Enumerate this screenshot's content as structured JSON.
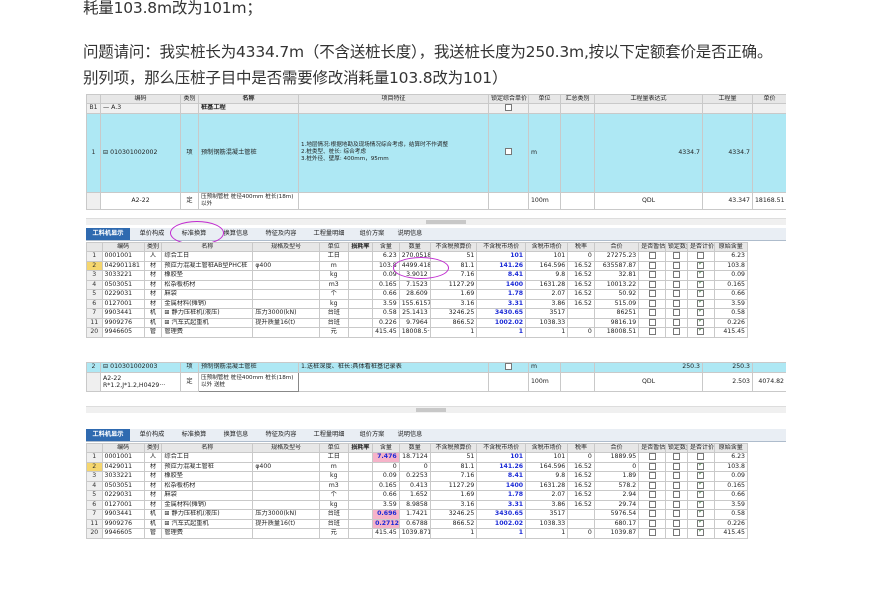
{
  "question": {
    "line0": "耗量103.8m改为101m；",
    "line1": "问题请问：我实桩长为4334.7m（不含送桩长度），我送桩长度为250.3m,按以下定额套价是否正确。",
    "line2": "别列项，那么压桩子目中是否需要修改消耗量103.8改为101）"
  },
  "top_grid": {
    "headers": [
      "编码",
      "类别",
      "名称",
      "项目特征",
      "锁定综合单价",
      "单位",
      "汇总类别",
      "工程量表达式",
      "工程量",
      "单价"
    ],
    "row_b1": {
      "num": "B1",
      "code": "— A.3",
      "name": "桩基工程"
    },
    "row_1": {
      "num": "1",
      "code": "010301002002",
      "type": "项",
      "name": "预制钢筋混凝土管桩",
      "feature": "1.地层情况:根据地勘及现场情况综合考虑，结算时不作调整\n2.桩类型、桩长: 综合考虑\n3.桩外径、壁厚: 400mm，95mm",
      "unit": "m",
      "expr": "4334.7",
      "qty": "4334.7"
    },
    "row_sub": {
      "code": "A2-22",
      "type": "定",
      "name": "压预制管桩 桩径400mm 桩长(18m)以外",
      "unit": "100m",
      "expr": "QDL",
      "qty": "43.347",
      "price": "18168.51"
    }
  },
  "tabs": [
    "工料机显示",
    "单价构成",
    "标准换算",
    "换算信息",
    "特征及内容",
    "工程量明细",
    "组价方案",
    "说明信息"
  ],
  "mat_headers": [
    "编码",
    "类别",
    "名称",
    "规格及型号",
    "单位",
    "损耗率",
    "含量",
    "数量",
    "不含税预算价",
    "不含税市场价",
    "含税市场价",
    "税率",
    "合价",
    "是否暂估",
    "锁定数量",
    "是否计价",
    "原始含量"
  ],
  "mat1_rows": [
    {
      "n": "1",
      "code": "0001001",
      "t": "人",
      "name": "综合工日",
      "spec": "",
      "unit": "工日",
      "loss": "",
      "qty": "6.23",
      "amt": "270.0518",
      "bud": "51",
      "mkt": "101",
      "tax": "101",
      "rate": "0",
      "sum": "27275.23",
      "chk": false,
      "orig": "6.23"
    },
    {
      "n": "2",
      "code": "042901181",
      "t": "材",
      "name": "预应力混凝土管桩AB型PHC桩",
      "spec": "φ400",
      "unit": "m",
      "loss": "",
      "qty": "103.8",
      "amt": "4499.4186",
      "bud": "81.1",
      "mkt": "141.26",
      "tax": "164.596",
      "rate": "16.52",
      "sum": "635587.87",
      "chk": true,
      "orig": "103.8"
    },
    {
      "n": "3",
      "code": "3033221",
      "t": "材",
      "name": "橡胶垫",
      "spec": "",
      "unit": "kg",
      "loss": "",
      "qty": "0.09",
      "amt": "3.9012",
      "bud": "7.16",
      "mkt": "8.41",
      "tax": "9.8",
      "rate": "16.52",
      "sum": "32.81",
      "chk": true,
      "orig": "0.09"
    },
    {
      "n": "4",
      "code": "0503051",
      "t": "材",
      "name": "松杂板枋材",
      "spec": "",
      "unit": "m3",
      "loss": "",
      "qty": "0.165",
      "amt": "7.1523",
      "bud": "1127.29",
      "mkt": "1400",
      "tax": "1631.28",
      "rate": "16.52",
      "sum": "10013.22",
      "chk": true,
      "orig": "0.165"
    },
    {
      "n": "5",
      "code": "0229031",
      "t": "材",
      "name": "麻袋",
      "spec": "",
      "unit": "个",
      "loss": "",
      "qty": "0.66",
      "amt": "28.609",
      "bud": "1.69",
      "mkt": "1.78",
      "tax": "2.07",
      "rate": "16.52",
      "sum": "50.92",
      "chk": true,
      "orig": "0.66"
    },
    {
      "n": "6",
      "code": "0127001",
      "t": "材",
      "name": "金属材料(摊销)",
      "spec": "",
      "unit": "kg",
      "loss": "",
      "qty": "3.59",
      "amt": "155.6157",
      "bud": "3.16",
      "mkt": "3.31",
      "tax": "3.86",
      "rate": "16.52",
      "sum": "515.09",
      "chk": true,
      "orig": "3.59"
    },
    {
      "n": "7",
      "code": "9903441",
      "t": "机",
      "name": "静力压桩机(液压)",
      "spec": "压力3000(kN)",
      "unit": "台班",
      "loss": "",
      "qty": "0.58",
      "amt": "25.1413",
      "bud": "3246.25",
      "mkt": "3430.65",
      "tax": "3517",
      "rate": "",
      "sum": "86251",
      "chk": true,
      "orig": "0.58"
    },
    {
      "n": "11",
      "code": "9909276",
      "t": "机",
      "name": "汽车式起重机",
      "spec": "提升质量16(t)",
      "unit": "台班",
      "loss": "",
      "qty": "0.226",
      "amt": "9.7964",
      "bud": "866.52",
      "mkt": "1002.02",
      "tax": "1038.33",
      "rate": "",
      "sum": "9816.19",
      "chk": true,
      "orig": "0.226"
    },
    {
      "n": "20",
      "code": "9946605",
      "t": "管",
      "name": "管理费",
      "spec": "",
      "unit": "元",
      "loss": "",
      "qty": "415.45",
      "amt": "18008.5···",
      "bud": "1",
      "mkt": "1",
      "tax": "1",
      "rate": "0",
      "sum": "18008.51",
      "chk": true,
      "orig": "415.45"
    }
  ],
  "mid_grid": {
    "row_2": {
      "num": "2",
      "code": "010301002003",
      "type": "项",
      "name": "预制钢筋混凝土管桩",
      "feature": "1.送桩深度、桩长:具体看桩基记录表",
      "unit": "m",
      "expr": "250.3",
      "qty": "250.3"
    },
    "row_sub": {
      "code": "A2-22",
      "code2": "R*1.2,J*1.2,H0429···",
      "type": "定",
      "name": "压预制管桩 桩径400mm 桩长(18m)以外 送桩",
      "unit": "100m",
      "expr": "QDL",
      "qty": "2.503",
      "price": "4074.82"
    }
  },
  "mat2_rows": [
    {
      "n": "1",
      "code": "0001001",
      "t": "人",
      "name": "综合工日",
      "spec": "",
      "unit": "工日",
      "loss": "",
      "qty": "7.476",
      "amt": "18.7124",
      "bud": "51",
      "mkt": "101",
      "tax": "101",
      "rate": "0",
      "sum": "1889.95",
      "chk": false,
      "orig": "6.23",
      "pinkqty": true
    },
    {
      "n": "2",
      "code": "0429011",
      "t": "材",
      "name": "预应力混凝土管桩",
      "spec": "φ400",
      "unit": "m",
      "loss": "",
      "qty": "0",
      "amt": "0",
      "bud": "81.1",
      "mkt": "141.26",
      "tax": "164.596",
      "rate": "16.52",
      "sum": "0",
      "chk": true,
      "orig": "103.8"
    },
    {
      "n": "3",
      "code": "3033221",
      "t": "材",
      "name": "橡胶垫",
      "spec": "",
      "unit": "kg",
      "loss": "",
      "qty": "0.09",
      "amt": "0.2253",
      "bud": "7.16",
      "mkt": "8.41",
      "tax": "9.8",
      "rate": "16.52",
      "sum": "1.89",
      "chk": true,
      "orig": "0.09"
    },
    {
      "n": "4",
      "code": "0503051",
      "t": "材",
      "name": "松杂板枋材",
      "spec": "",
      "unit": "m3",
      "loss": "",
      "qty": "0.165",
      "amt": "0.413",
      "bud": "1127.29",
      "mkt": "1400",
      "tax": "1631.28",
      "rate": "16.52",
      "sum": "578.2",
      "chk": true,
      "orig": "0.165"
    },
    {
      "n": "5",
      "code": "0229031",
      "t": "材",
      "name": "麻袋",
      "spec": "",
      "unit": "个",
      "loss": "",
      "qty": "0.66",
      "amt": "1.652",
      "bud": "1.69",
      "mkt": "1.78",
      "tax": "2.07",
      "rate": "16.52",
      "sum": "2.94",
      "chk": true,
      "orig": "0.66"
    },
    {
      "n": "6",
      "code": "0127001",
      "t": "材",
      "name": "金属材料(摊销)",
      "spec": "",
      "unit": "kg",
      "loss": "",
      "qty": "3.59",
      "amt": "8.9858",
      "bud": "3.16",
      "mkt": "3.31",
      "tax": "3.86",
      "rate": "16.52",
      "sum": "29.74",
      "chk": true,
      "orig": "3.59"
    },
    {
      "n": "7",
      "code": "9903441",
      "t": "机",
      "name": "静力压桩机(液压)",
      "spec": "压力3000(kN)",
      "unit": "台班",
      "loss": "",
      "qty": "0.696",
      "amt": "1.7421",
      "bud": "3246.25",
      "mkt": "3430.65",
      "tax": "3517",
      "rate": "",
      "sum": "5976.54",
      "chk": true,
      "orig": "0.58",
      "pinkqty": true
    },
    {
      "n": "11",
      "code": "9909276",
      "t": "机",
      "name": "汽车式起重机",
      "spec": "提升质量16(t)",
      "unit": "台班",
      "loss": "",
      "qty": "0.2712",
      "amt": "0.6788",
      "bud": "866.52",
      "mkt": "1002.02",
      "tax": "1038.33",
      "rate": "",
      "sum": "680.17",
      "chk": true,
      "orig": "0.226",
      "pinkqty": true
    },
    {
      "n": "20",
      "code": "9946605",
      "t": "管",
      "name": "管理费",
      "spec": "",
      "unit": "元",
      "loss": "",
      "qty": "415.45",
      "amt": "1039.8714",
      "bud": "1",
      "mkt": "1",
      "tax": "1",
      "rate": "0",
      "sum": "1039.87",
      "chk": true,
      "orig": "415.45"
    }
  ],
  "colors": {
    "tab_active": "#2f6ab0",
    "cyan_row": "#aee8f4",
    "name_header": "#fbe68e",
    "pink": "#f6b3c9",
    "annotation": "#c02ad0",
    "blue_value": "#1b2bd6"
  }
}
